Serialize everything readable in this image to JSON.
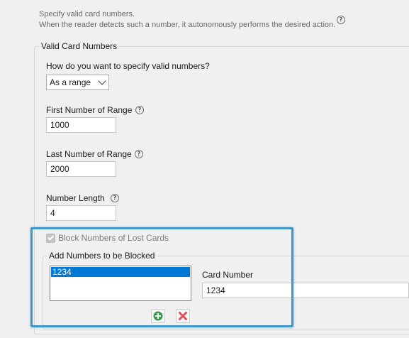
{
  "description": {
    "line1": "Specify valid card numbers.",
    "line2": "When the reader detects such a number, it autonomously performs the desired action."
  },
  "valid_card_numbers": {
    "legend": "Valid Card Numbers",
    "spec_question": "How do you want to specify valid numbers?",
    "spec_selected": "As a range",
    "first_label": "First Number of Range",
    "first_value": "1000",
    "last_label": "Last Number of Range",
    "last_value": "2000",
    "length_label": "Number Length",
    "length_value": "4"
  },
  "block_lost": {
    "checkbox_label": "Block Numbers of Lost Cards",
    "checked": true,
    "add_legend": "Add Numbers to be Blocked",
    "list_items": [
      "1234"
    ],
    "card_number_label": "Card Number",
    "card_number_value": "1234"
  },
  "icons": {
    "help": "help-circle-icon",
    "add": "plus-circle-icon",
    "remove": "x-delete-icon"
  },
  "colors": {
    "highlight": "#3e97cd",
    "selection": "#0078d7",
    "add_green": "#3a9a4b",
    "remove_red": "#e0505a"
  }
}
